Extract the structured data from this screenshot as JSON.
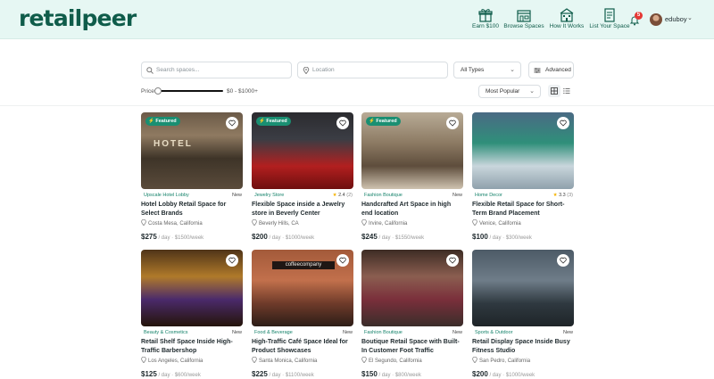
{
  "app": {
    "logo": "retailpeer"
  },
  "nav": [
    {
      "label": "Earn $100",
      "icon": "gift-icon"
    },
    {
      "label": "Browse Spaces",
      "icon": "storefront-icon"
    },
    {
      "label": "How It Works",
      "icon": "building-icon"
    },
    {
      "label": "List Your Space",
      "icon": "document-icon"
    }
  ],
  "notifications": {
    "count": "5",
    "icon": "bell-icon"
  },
  "user": {
    "name": "eduboy"
  },
  "filters": {
    "search_placeholder": "Search spaces...",
    "location_placeholder": "Location",
    "types": "All Types",
    "advanced": "Advanced",
    "price_label": "Price:",
    "price_range": "$0 - $1000+",
    "price_slider_value": 0,
    "sort": "Most Popular",
    "view_mode": "grid"
  },
  "colors": {
    "brand": "#0f5c4a",
    "accent": "#1a8f72",
    "header_bg": "#e6f7f3",
    "star": "#f5b301"
  },
  "listings": [
    {
      "category": "Upscale Hotel Lobby",
      "badge": "New",
      "featured": "Featured",
      "title": "Hotel Lobby Retail Space for Select Brands",
      "location": "Costa Mesa, California",
      "price": "$275",
      "per_day": "/ day",
      "per_week": "$1500/week",
      "caption": "HOTEL"
    },
    {
      "category": "Jewelry Store",
      "featured": "Featured",
      "rating": "2.4",
      "reviews": "(2)",
      "title": "Flexible Space inside a Jewelry store in Beverly Center",
      "location": "Beverly Hills, CA",
      "price": "$200",
      "per_day": "/ day",
      "per_week": "$1000/week"
    },
    {
      "category": "Fashion Boutique",
      "badge": "New",
      "featured": "Featured",
      "title": "Handcrafted Art Space in high end location",
      "location": "Irvine, California",
      "price": "$245",
      "per_day": "/ day",
      "per_week": "$1550/week"
    },
    {
      "category": "Home Decor",
      "rating": "3.3",
      "reviews": "(3)",
      "title": "Flexible Retail Space for Short-Term Brand Placement",
      "location": "Venice, California",
      "price": "$100",
      "per_day": "/ day",
      "per_week": "$300/week"
    },
    {
      "category": "Beauty & Cosmetics",
      "badge": "New",
      "title": "Retail Shelf Space Inside High-Traffic Barbershop",
      "location": "Los Angeles, California",
      "price": "$125",
      "per_day": "/ day",
      "per_week": "$600/week"
    },
    {
      "category": "Food & Beverage",
      "badge": "New",
      "title": "High-Traffic Café Space Ideal for Product Showcases",
      "location": "Santa Monica, California",
      "price": "$225",
      "per_day": "/ day",
      "per_week": "$1100/week",
      "caption": "coffeecompany"
    },
    {
      "category": "Fashion Boutique",
      "badge": "New",
      "title": "Boutique Retail Space with Built-In Customer Foot Traffic",
      "location": "El Segundo, California",
      "price": "$150",
      "per_day": "/ day",
      "per_week": "$800/week"
    },
    {
      "category": "Sports & Outdoor",
      "badge": "New",
      "title": "Retail Display Space Inside Busy Fitness Studio",
      "location": "San Pedro, California",
      "price": "$200",
      "per_day": "/ day",
      "per_week": "$1000/week"
    }
  ]
}
